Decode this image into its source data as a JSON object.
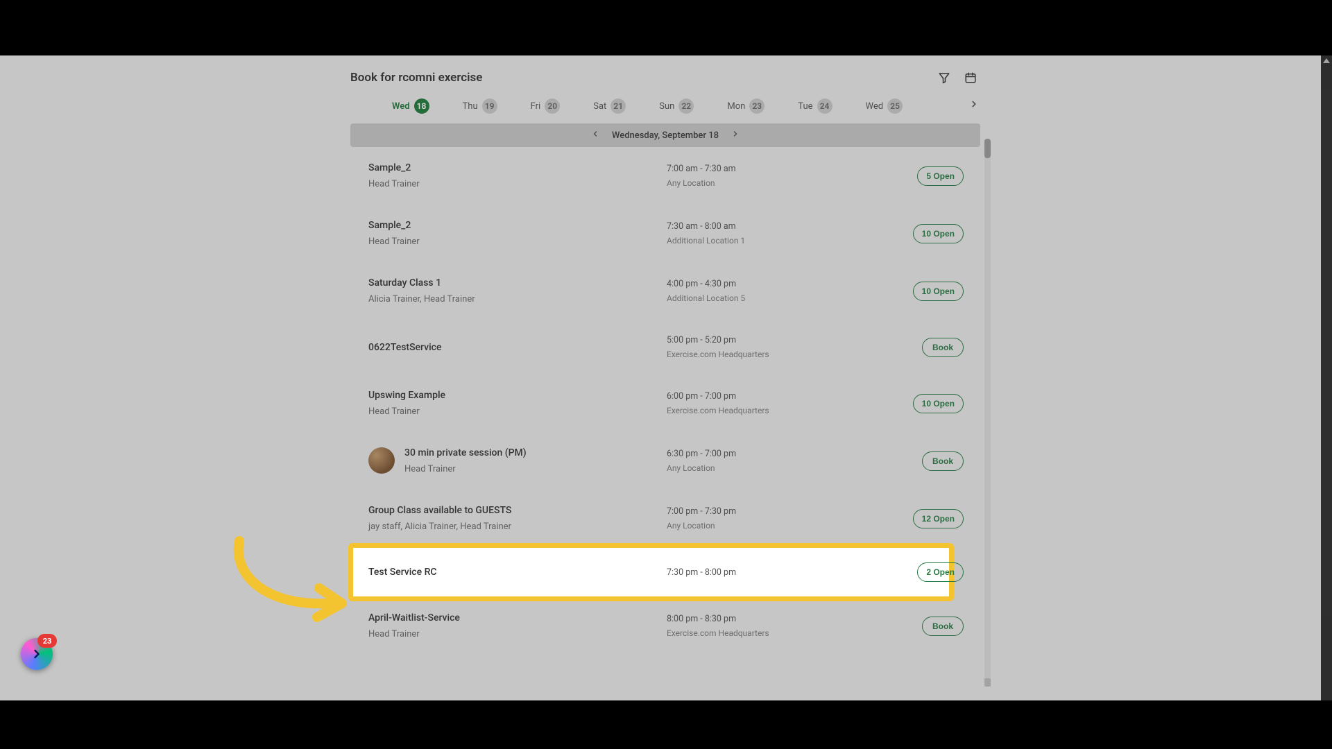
{
  "page_title": "Book for rcomni exercise",
  "days": [
    {
      "label": "Wed",
      "num": "18",
      "active": true
    },
    {
      "label": "Thu",
      "num": "19",
      "active": false
    },
    {
      "label": "Fri",
      "num": "20",
      "active": false
    },
    {
      "label": "Sat",
      "num": "21",
      "active": false
    },
    {
      "label": "Sun",
      "num": "22",
      "active": false
    },
    {
      "label": "Mon",
      "num": "23",
      "active": false
    },
    {
      "label": "Tue",
      "num": "24",
      "active": false
    },
    {
      "label": "Wed",
      "num": "25",
      "active": false
    }
  ],
  "date_bar": "Wednesday, September 18",
  "services": [
    {
      "name": "Sample_2",
      "sub": "Head Trainer",
      "time": "7:00 am - 7:30 am",
      "loc": "Any Location",
      "btn": "5 Open",
      "avatar": false
    },
    {
      "name": "Sample_2",
      "sub": "Head Trainer",
      "time": "7:30 am - 8:00 am",
      "loc": "Additional Location 1",
      "btn": "10 Open",
      "avatar": false
    },
    {
      "name": "Saturday Class 1",
      "sub": "Alicia Trainer, Head Trainer",
      "time": "4:00 pm - 4:30 pm",
      "loc": "Additional Location 5",
      "btn": "10 Open",
      "avatar": false
    },
    {
      "name": "0622TestService",
      "sub": "",
      "time": "5:00 pm - 5:20 pm",
      "loc": "Exercise.com Headquarters",
      "btn": "Book",
      "avatar": false
    },
    {
      "name": "Upswing Example",
      "sub": "Head Trainer",
      "time": "6:00 pm - 7:00 pm",
      "loc": "Exercise.com Headquarters",
      "btn": "10 Open",
      "avatar": false
    },
    {
      "name": "30 min private session (PM)",
      "sub": "Head Trainer",
      "time": "6:30 pm - 7:00 pm",
      "loc": "Any Location",
      "btn": "Book",
      "avatar": true
    },
    {
      "name": "Group Class available to GUESTS",
      "sub": "jay staff, Alicia Trainer, Head Trainer",
      "time": "7:00 pm - 7:30 pm",
      "loc": "Any Location",
      "btn": "12 Open",
      "avatar": false
    },
    {
      "name": "Test Service RC",
      "sub": "",
      "time": "7:30 pm - 8:00 pm",
      "loc": "",
      "btn": "2 Open",
      "avatar": false,
      "highlight": true
    },
    {
      "name": "April-Waitlist-Service",
      "sub": "Head Trainer",
      "time": "8:00 pm - 8:30 pm",
      "loc": "Exercise.com Headquarters",
      "btn": "Book",
      "avatar": false
    }
  ],
  "float_badge_count": "23"
}
